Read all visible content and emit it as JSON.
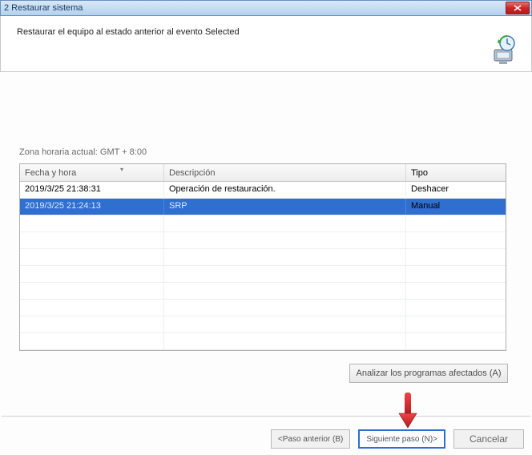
{
  "window": {
    "title": "2 Restaurar sistema"
  },
  "header": {
    "text": "Restaurar el equipo al estado anterior al evento Selected"
  },
  "timezone_label": "Zona horaria actual: GMT + 8:00",
  "grid": {
    "columns": {
      "datetime": "Fecha y hora",
      "description": "Descripción",
      "type": "Tipo"
    },
    "rows": [
      {
        "datetime": "2019/3/25 21:38:31",
        "description": "Operación de restauración.",
        "type": "Deshacer",
        "selected": false
      },
      {
        "datetime": "2019/3/25 21:24:13",
        "description": "SRP",
        "type": "Manual",
        "selected": true
      }
    ]
  },
  "buttons": {
    "analyze": "Analizar los programas afectados (A)",
    "prev": "<Paso anterior (B)",
    "next": "Siguiente paso (N)>",
    "cancel": "Cancelar"
  },
  "colors": {
    "selected_row": "#2f6fd0",
    "arrow": "#d2232a"
  }
}
